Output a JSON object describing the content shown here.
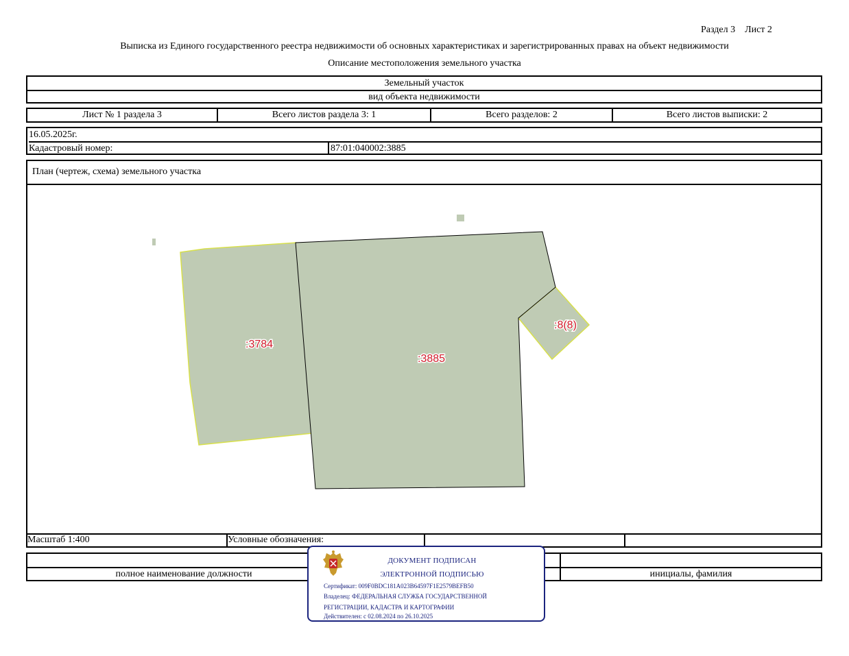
{
  "header": {
    "section_sheet": "Раздел 3    Лист 2",
    "title": "Выписка из Единого государственного реестра недвижимости об основных характеристиках и зарегистрированных правах на объект недвижимости",
    "subtitle": "Описание местоположения земельного участка"
  },
  "object": {
    "name": "Земельный участок",
    "type_caption": "вид объекта недвижимости"
  },
  "sheets": {
    "sheet_no": "Лист № 1 раздела 3",
    "total_in_section": "Всего листов раздела 3: 1",
    "total_sections": "Всего разделов: 2",
    "total_sheets": "Всего листов выписки: 2"
  },
  "info": {
    "date": "16.05.2025г.",
    "cadastral_label": "Кадастровый номер:",
    "cadastral_value": "87:01:040002:3885"
  },
  "plan": {
    "title": "План (чертеж, схема) земельного участка",
    "parcels": [
      ":3784",
      ":3885",
      ":8(8)"
    ],
    "fill_color": "#bfcbb4",
    "neighbor_border_color": "#d8e04a",
    "label_color": "#d11a2a"
  },
  "footer": {
    "scale": "Масштаб 1:400",
    "legend": "Условные обозначения:",
    "position_caption": "полное наименование должности",
    "initials_caption": "инициалы, фамилия"
  },
  "stamp": {
    "line1": "ДОКУМЕНТ ПОДПИСАН",
    "line2": "ЭЛЕКТРОННОЙ ПОДПИСЬЮ",
    "certificate": "Сертификат: 009F0BDC181A023B64597F1E2579BEFB50",
    "owner1": "Владелец: ФЕДЕРАЛЬНАЯ СЛУЖБА ГОСУДАРСТВЕННОЙ",
    "owner2": "РЕГИСТРАЦИИ, КАДАСТРА И КАРТОГРАФИИ",
    "valid": "Действителен: с 02.08.2024 по 26.10.2025",
    "border_color": "#1a237e",
    "emblem_icon": "coat-of-arms-icon"
  }
}
